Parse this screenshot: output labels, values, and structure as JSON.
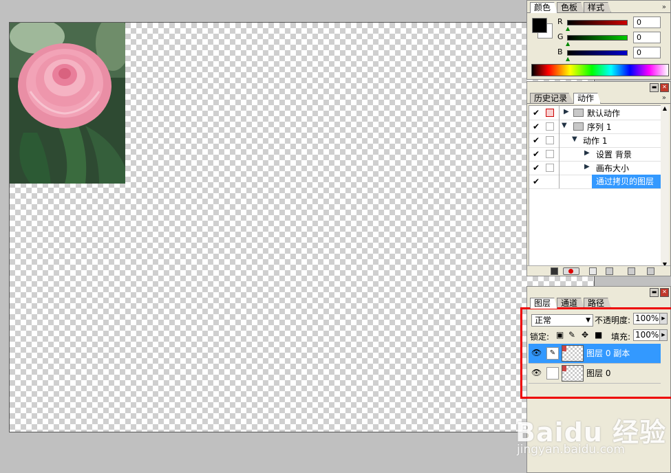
{
  "color_panel": {
    "tabs": [
      "颜色",
      "色板",
      "样式"
    ],
    "sliders": [
      {
        "label": "R",
        "value": "0",
        "color": "#cc0000"
      },
      {
        "label": "G",
        "value": "0",
        "color": "#00aa00"
      },
      {
        "label": "B",
        "value": "0",
        "color": "#0000cc"
      }
    ]
  },
  "actions_panel": {
    "tabs": [
      "历史记录",
      "动作"
    ],
    "rows": [
      {
        "label": "默认动作",
        "kind": "set",
        "checked": "✔"
      },
      {
        "label": "序列 1",
        "kind": "set-open",
        "checked": "✔"
      },
      {
        "label": "动作 1",
        "kind": "action-open",
        "checked": "✔"
      },
      {
        "label": "设置 背景",
        "kind": "step",
        "checked": "✔"
      },
      {
        "label": "画布大小",
        "kind": "step",
        "checked": "✔"
      },
      {
        "label": "通过拷贝的图层",
        "kind": "step-selected",
        "checked": "✔"
      }
    ]
  },
  "layers_panel": {
    "tabs": [
      "图层",
      "通道",
      "路径"
    ],
    "blend_mode": "正常",
    "opacity_label": "不透明度:",
    "opacity_value": "100%",
    "lock_label": "锁定:",
    "fill_label": "填充:",
    "fill_value": "100%",
    "layers": [
      {
        "name": "图层 0 副本",
        "selected": true
      },
      {
        "name": "图层 0",
        "selected": false
      }
    ]
  },
  "watermark": {
    "brand": "Baidu 经验",
    "url": "jingyan.baidu.com"
  },
  "colors": {
    "selection": "#3399ff",
    "highlight_box": "#e00000"
  }
}
